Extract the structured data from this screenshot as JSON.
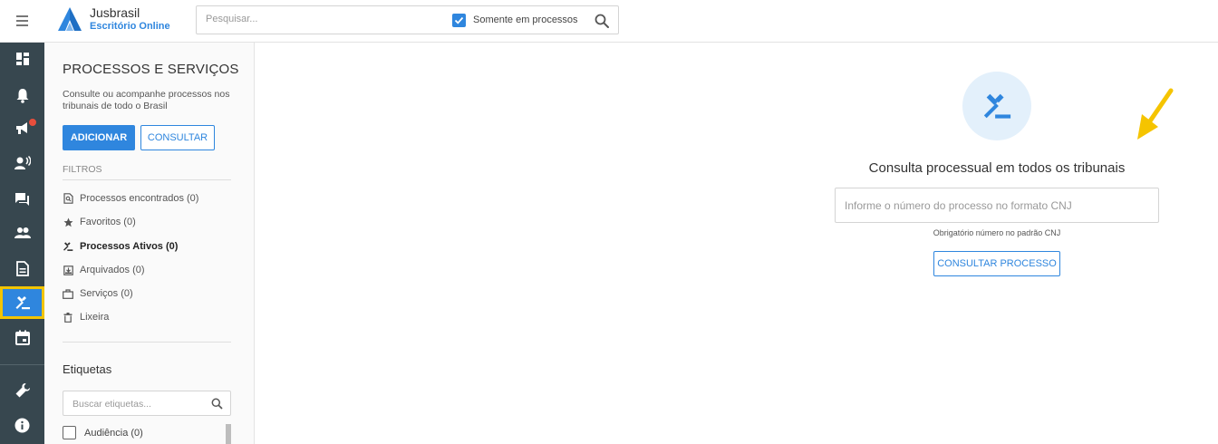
{
  "header": {
    "brand_name": "Jusbrasil",
    "brand_sub": "Escritório Online",
    "search_placeholder": "Pesquisar...",
    "checkbox_label": "Somente em processos",
    "checkbox_checked": true
  },
  "rail": {
    "items": [
      {
        "name": "dashboard",
        "icon": "dashboard-icon"
      },
      {
        "name": "notifications",
        "icon": "bell-icon"
      },
      {
        "name": "intimations",
        "icon": "megaphone-icon",
        "badge": true
      },
      {
        "name": "contacts",
        "icon": "person-voice-icon"
      },
      {
        "name": "messages",
        "icon": "chat-icon"
      },
      {
        "name": "clients",
        "icon": "people-icon"
      },
      {
        "name": "documents",
        "icon": "document-icon"
      },
      {
        "name": "processes",
        "icon": "gavel-icon",
        "active": true
      },
      {
        "name": "calendar",
        "icon": "calendar-icon"
      },
      {
        "name": "tools",
        "icon": "wrench-icon"
      },
      {
        "name": "info",
        "icon": "info-icon"
      }
    ]
  },
  "panel": {
    "title": "PROCESSOS E SERVIÇOS",
    "description": "Consulte ou acompanhe processos nos tribunais de todo o Brasil",
    "add_label": "ADICIONAR",
    "consult_label": "CONSULTAR",
    "filters_label": "FILTROS",
    "filters": [
      {
        "label": "Processos encontrados (0)",
        "icon": "search-document-icon"
      },
      {
        "label": "Favoritos (0)",
        "icon": "star-icon"
      },
      {
        "label": "Processos Ativos (0)",
        "icon": "gavel-icon",
        "active": true
      },
      {
        "label": "Arquivados (0)",
        "icon": "archive-icon"
      },
      {
        "label": "Serviços (0)",
        "icon": "briefcase-icon"
      },
      {
        "label": "Lixeira",
        "icon": "trash-icon"
      }
    ],
    "tags_title": "Etiquetas",
    "tags_placeholder": "Buscar etiquetas...",
    "tags": [
      {
        "label": "Audiência (0)"
      }
    ]
  },
  "main": {
    "title": "Consulta processual em todos os tribunais",
    "input_placeholder": "Informe o número do processo no formato CNJ",
    "hint": "Obrigatório número no padrão CNJ",
    "button_label": "CONSULTAR PROCESSO"
  },
  "colors": {
    "accent": "#2f86de",
    "rail_bg": "#37474f",
    "highlight": "#f2c400",
    "badge": "#e84e3c"
  }
}
